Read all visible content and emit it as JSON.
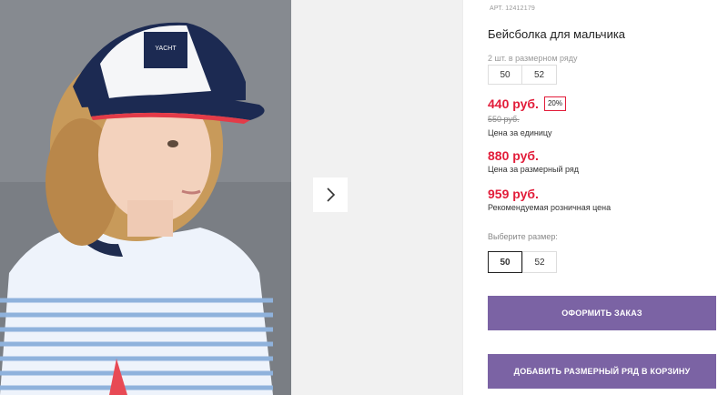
{
  "product": {
    "article_label": "АРТ.",
    "article": "12412179",
    "title": "Бейсболка для мальчика",
    "row_note": "2 шт. в размерном ряду",
    "row_sizes": [
      "50",
      "52"
    ]
  },
  "prices": {
    "unit_price": "440 руб.",
    "discount": "20%",
    "old_price": "550 руб.",
    "unit_caption": "Цена за единицу",
    "row_price": "880 руб.",
    "row_caption": "Цена за размерный ряд",
    "retail_price": "959 руб.",
    "retail_caption": "Рекомендуемая розничная цена"
  },
  "size_picker": {
    "label": "Выберите размер:",
    "options": [
      "50",
      "52"
    ],
    "selected": "50"
  },
  "actions": {
    "order": "ОФОРМИТЬ ЗАКАЗ",
    "add_row": "ДОБАВИТЬ РАЗМЕРНЫЙ РЯД В КОРЗИНУ"
  },
  "colors": {
    "accent": "#7b63a4",
    "price": "#e21d3a"
  },
  "icons": {
    "next": "chevron-right-icon"
  }
}
